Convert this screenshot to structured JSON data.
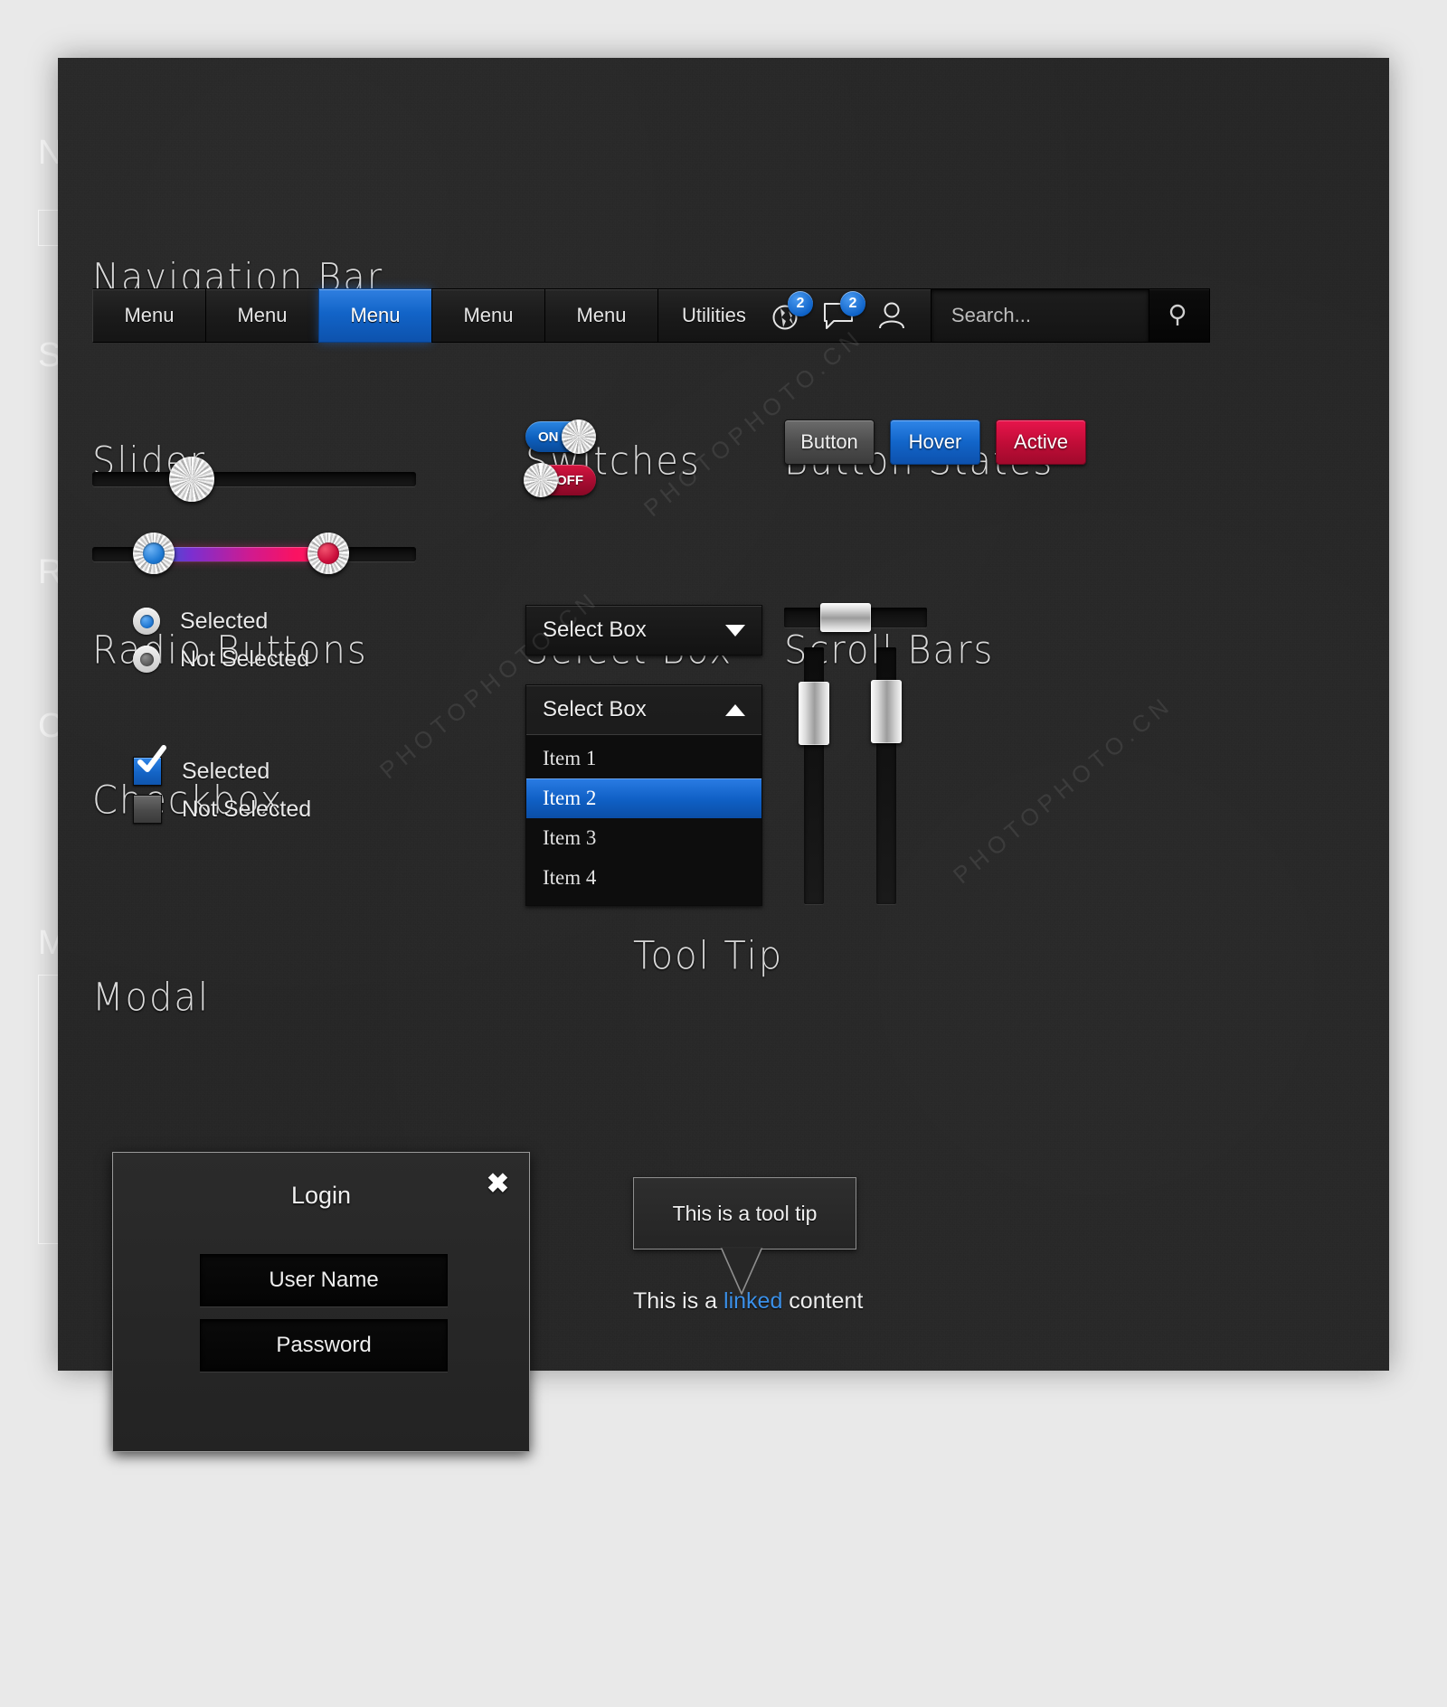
{
  "page": {
    "bg_color": "#e9e9e9",
    "sheet_color": "#272727",
    "accent_blue": "#1264c8",
    "accent_crimson": "#c20d38"
  },
  "sections": {
    "navigation_bar": "Navigation Bar",
    "slider": "Slider",
    "switches": "Switches",
    "button_states": "Button States",
    "radio_buttons": "Radio Buttons",
    "select_box": "Select Box",
    "scroll_bars": "Scroll Bars",
    "checkbox": "Checkbox",
    "modal": "Modal",
    "tool_tip": "Tool Tip"
  },
  "navbar": {
    "items": [
      {
        "label": "Menu",
        "active": false
      },
      {
        "label": "Menu",
        "active": false
      },
      {
        "label": "Menu",
        "active": true
      },
      {
        "label": "Menu",
        "active": false
      },
      {
        "label": "Menu",
        "active": false
      }
    ],
    "utilities_label": "Utilities",
    "icons": [
      {
        "name": "globe-icon",
        "badge": "2"
      },
      {
        "name": "message-icon",
        "badge": "2"
      },
      {
        "name": "user-icon",
        "badge": ""
      }
    ],
    "search": {
      "placeholder": "Search...",
      "value": "Search...",
      "button_icon": "search-icon"
    }
  },
  "slider": {
    "single": {
      "value_percent": 42
    },
    "range": {
      "low_percent": 18,
      "high_percent": 72
    }
  },
  "switches": [
    {
      "label": "ON",
      "state": "on",
      "color": "#0d5fbd"
    },
    {
      "label": "OFF",
      "state": "off",
      "color": "#a60c31"
    }
  ],
  "buttons": [
    {
      "label": "Button",
      "state": "normal"
    },
    {
      "label": "Hover",
      "state": "hover"
    },
    {
      "label": "Active",
      "state": "active"
    }
  ],
  "radios": [
    {
      "label": "Selected",
      "selected": true
    },
    {
      "label": "Not Selected",
      "selected": false
    }
  ],
  "checkboxes": [
    {
      "label": "Selected",
      "checked": true
    },
    {
      "label": "Not Selected",
      "checked": false
    }
  ],
  "select_closed": {
    "value": "Select Box",
    "arrow": "chevron-down-icon"
  },
  "select_open": {
    "value": "Select Box",
    "arrow": "chevron-up-icon",
    "options": [
      "Item 1",
      "Item 2",
      "Item 3",
      "Item 4"
    ],
    "highlighted": "Item 2"
  },
  "scrollbars": {
    "horizontal": {
      "thumb_percent": 30
    },
    "vertical_left": {
      "thumb_percent": 22
    },
    "vertical_right": {
      "thumb_percent": 18
    }
  },
  "modal": {
    "title": "Login",
    "close_icon": "close-icon",
    "fields": [
      {
        "label": "User Name"
      },
      {
        "label": "Password"
      }
    ]
  },
  "tooltip": {
    "text": "This is a tool tip",
    "content_before": "This is a ",
    "link": "linked",
    "content_after": " content",
    "link_color": "#3b90e8"
  },
  "ghost": {
    "nav": "N",
    "slider": "S",
    "radio": "R",
    "check": "C",
    "modal": "M"
  },
  "watermark": {
    "brand": "PHOTOPHOTO.CN"
  }
}
